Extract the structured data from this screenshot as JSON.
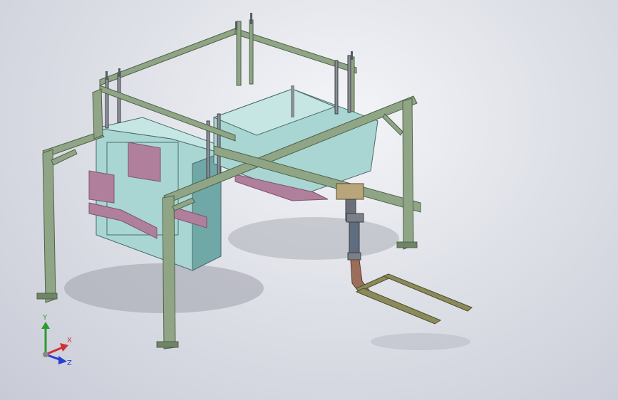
{
  "viewport": {
    "background_top": "#f4f5f8",
    "background_bottom": "#c8cbd6"
  },
  "colors": {
    "frame_green": "#8fa585",
    "frame_green_dark": "#5e7358",
    "panel_cyan": "#a9d6d2",
    "panel_cyan_dark": "#6fa8a6",
    "bracket_pink": "#b07f9c",
    "bracket_pink_dark": "#7e5570",
    "rod_gray": "#8a8e96",
    "conveyor_olive": "#8a8a5a",
    "pipe_brown": "#9a6e5a"
  },
  "model": {
    "name_icon": "cad-assembly-icon"
  },
  "triad": {
    "y_label": "Y",
    "x_label": "X",
    "z_label": "Z",
    "y_color": "#2f9a2f",
    "x_color": "#d23030",
    "z_color": "#2a3fd0"
  }
}
